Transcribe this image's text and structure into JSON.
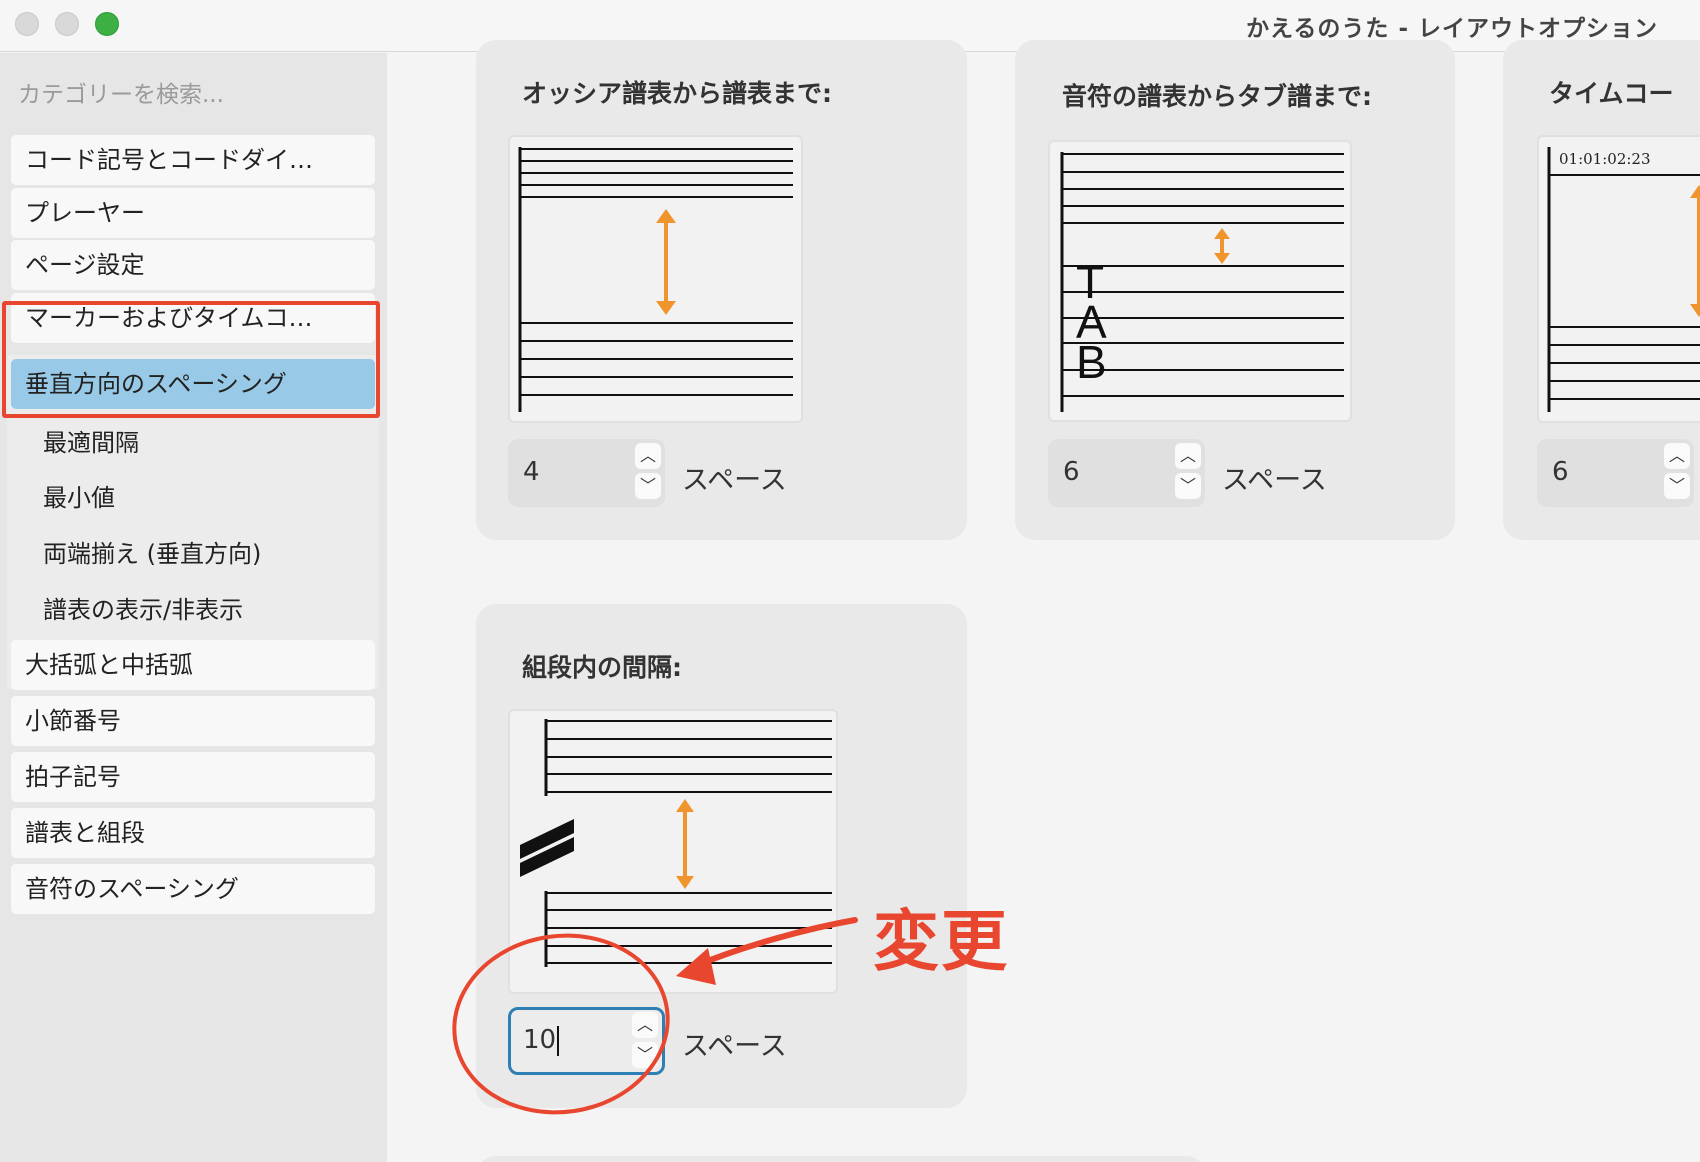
{
  "window": {
    "title": "かえるのうた - レイアウトオプション"
  },
  "sidebar": {
    "search_placeholder": "カテゴリーを検索...",
    "items": [
      {
        "label": "コード記号とコードダイ…"
      },
      {
        "label": "プレーヤー"
      },
      {
        "label": "ページ設定"
      },
      {
        "label": "マーカーおよびタイムコ…"
      },
      {
        "label": "垂直方向のスペーシング",
        "selected": true
      },
      {
        "label": "大括弧と中括弧"
      },
      {
        "label": "小節番号"
      },
      {
        "label": "拍子記号"
      },
      {
        "label": "譜表と組段"
      },
      {
        "label": "音符のスペーシング"
      }
    ],
    "sub_items": [
      {
        "label": "最適間隔"
      },
      {
        "label": "最小値"
      },
      {
        "label": "両端揃え (垂直方向)"
      },
      {
        "label": "譜表の表示/非表示"
      }
    ]
  },
  "panels": [
    {
      "title": "オッシア譜表から譜表まで:",
      "value": "4",
      "unit": "スペース"
    },
    {
      "title": "音符の譜表からタブ譜まで:",
      "value": "6",
      "unit": "スペース",
      "tab_letters": [
        "T",
        "A",
        "B"
      ]
    },
    {
      "title": "タイムコー",
      "value": "6",
      "timecode": "01:01:02:23"
    },
    {
      "title": "組段内の間隔:",
      "value": "10",
      "unit": "スペース"
    }
  ],
  "annotation": {
    "text": "変更",
    "color": "#e8462e"
  },
  "colors": {
    "accent_arrow": "#f0952e",
    "selection": "#98c9e6",
    "focus_ring": "#2e7fb3"
  }
}
